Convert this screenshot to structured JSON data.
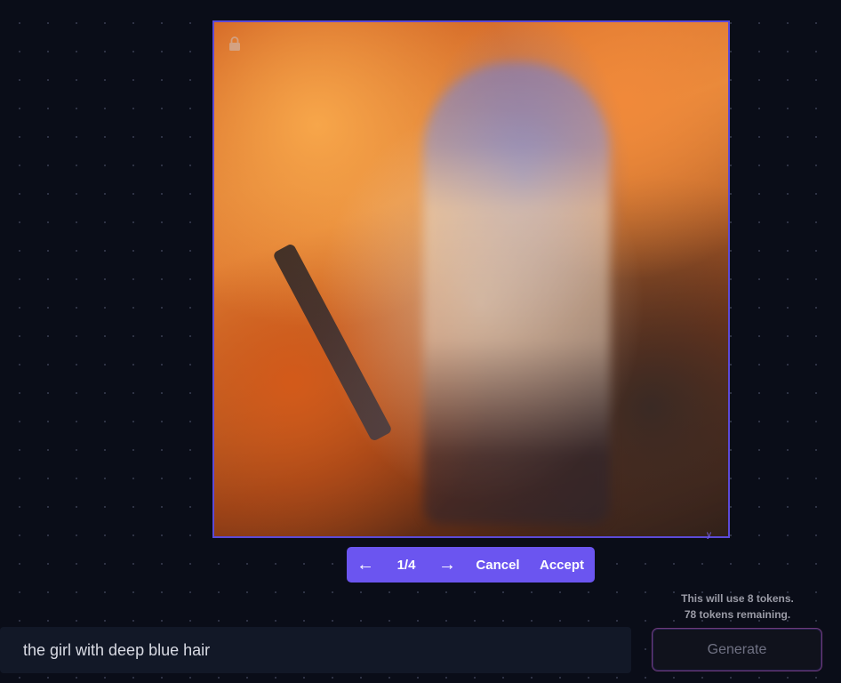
{
  "preview": {
    "caption": "y"
  },
  "navigator": {
    "prev_arrow": "←",
    "counter": "1/4",
    "next_arrow": "→",
    "cancel_label": "Cancel",
    "accept_label": "Accept"
  },
  "tokens": {
    "usage_text": "This will use 8 tokens.",
    "remaining_text": "78 tokens remaining."
  },
  "prompt": {
    "value": "the girl with deep blue hair",
    "placeholder": ""
  },
  "generate": {
    "label": "Generate"
  },
  "colors": {
    "accent": "#6b55f0",
    "frame_border": "#5b4ad8",
    "background": "#0a0d18"
  }
}
